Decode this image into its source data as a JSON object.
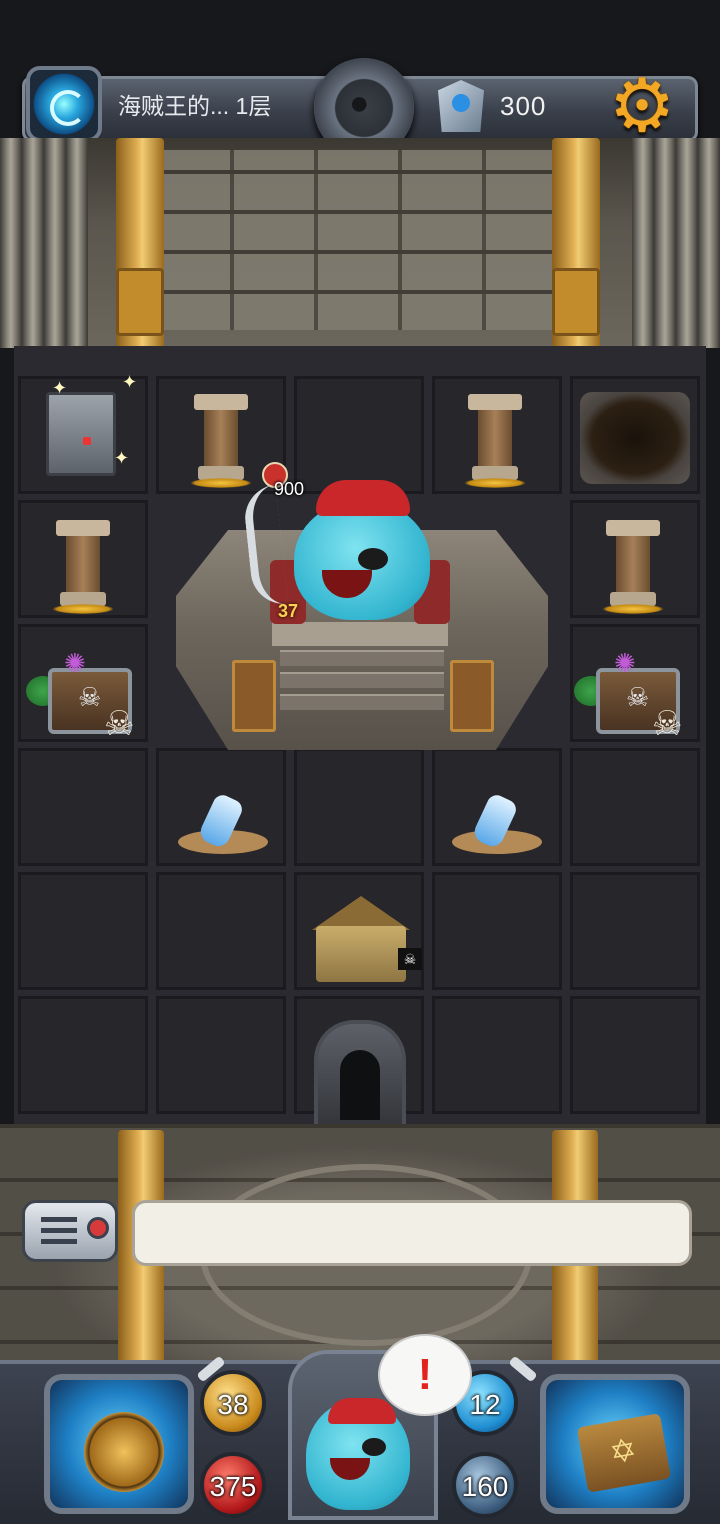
{
  "header": {
    "floor_label": "海贼王的... 1层",
    "gem_count": "300",
    "icons": {
      "portal": "portal-icon",
      "bomb_dial": "bomb-icon",
      "gem": "gem-icon",
      "settings": "gear-icon"
    }
  },
  "board": {
    "boss": {
      "name_icon": "pirate-king-boss",
      "hp": "900",
      "atk": "37"
    },
    "tiles": [
      "vault-chest",
      "pillar",
      "pillar",
      "collapsed-hole",
      "pillar",
      "pillar",
      "skull-chest",
      "skull-chest",
      "message-bottle",
      "message-bottle",
      "merchant-tent",
      "stairs-door"
    ]
  },
  "dialogue": {
    "text": ""
  },
  "hud": {
    "attack": "38",
    "hp": "375",
    "defense": "12",
    "gold": "160",
    "alert_mark": "!"
  },
  "colors": {
    "accent_gold": "#f2a725",
    "boss_skin": "#33b5d0",
    "alert_red": "#e3241e"
  }
}
